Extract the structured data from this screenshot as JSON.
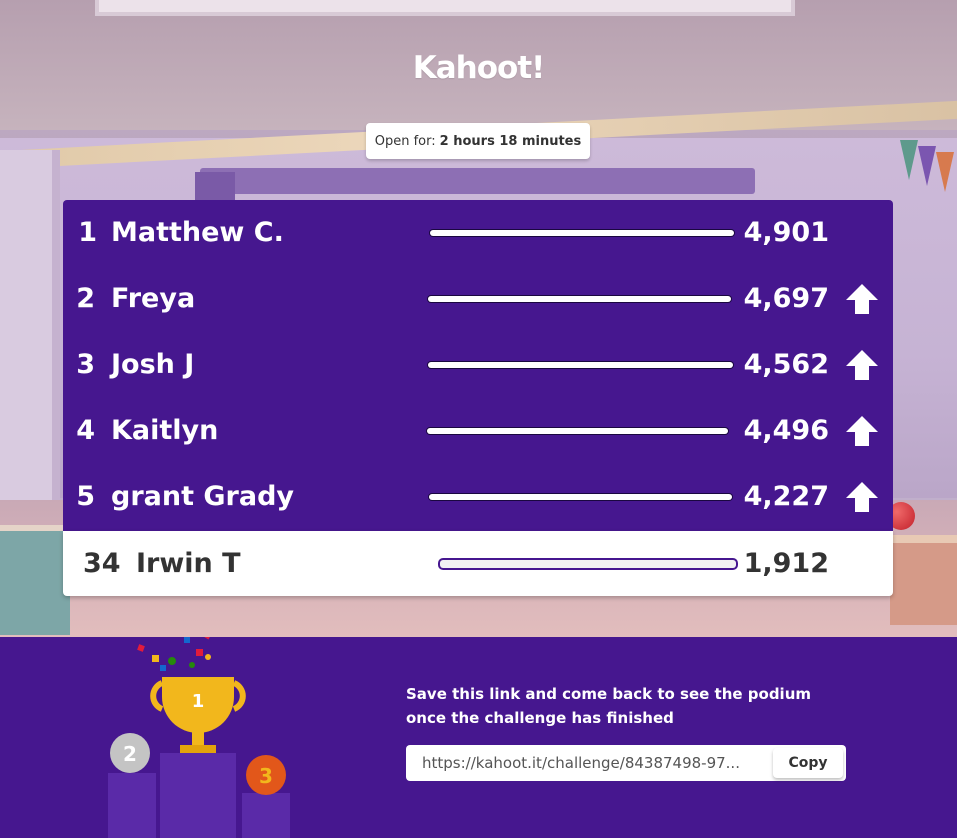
{
  "brand": {
    "logo_text": "Kahoot!"
  },
  "timer": {
    "label": "Open for:",
    "value": "2 hours 18 minutes"
  },
  "leaderboard": {
    "rows": [
      {
        "rank": "1",
        "name": "Matthew C.",
        "score": "4,901",
        "trend": "none"
      },
      {
        "rank": "2",
        "name": "Freya",
        "score": "4,697",
        "trend": "up"
      },
      {
        "rank": "3",
        "name": "Josh J",
        "score": "4,562",
        "trend": "up"
      },
      {
        "rank": "4",
        "name": "Kaitlyn",
        "score": "4,496",
        "trend": "up"
      },
      {
        "rank": "5",
        "name": "grant Grady",
        "score": "4,227",
        "trend": "up"
      }
    ],
    "current_player": {
      "rank": "34",
      "name": "Irwin T",
      "score": "1,912"
    }
  },
  "footer": {
    "message": "Save this link and come back to see the podium once the challenge has finished",
    "link": "https://kahoot.it/challenge/84387498-97...",
    "copy_label": "Copy",
    "podium_labels": [
      "1",
      "2",
      "3"
    ]
  },
  "colors": {
    "primary_purple": "#46178f",
    "gold": "#f2b71c",
    "silver": "#c4c4c4",
    "bronze": "#e2571a"
  },
  "icons": [
    "up-arrow-icon",
    "trophy-icon"
  ]
}
